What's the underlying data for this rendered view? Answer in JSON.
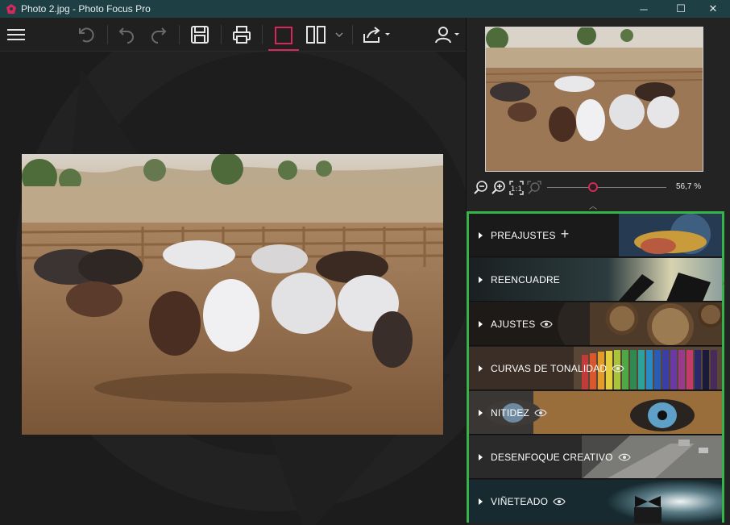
{
  "window": {
    "title": "Photo 2.jpg - Photo Focus Pro",
    "minimize": "─",
    "maximize": "☐",
    "close": "✕"
  },
  "toolbar": {
    "buttons": [
      "menu-icon",
      "undo-all-icon",
      "undo-icon",
      "redo-icon",
      "save-icon",
      "print-icon",
      "single-view-icon",
      "split-view-icon",
      "split-dropdown-icon",
      "share-icon",
      "account-icon"
    ]
  },
  "zoom": {
    "value": "56,7 %",
    "level": 0.385
  },
  "sections": [
    {
      "label": "PREAJUSTES",
      "extra": "+",
      "extra_icon": "plus-icon",
      "theme": "lamp"
    },
    {
      "label": "REENCUADRE",
      "extra": "",
      "extra_icon": "",
      "theme": "hands"
    },
    {
      "label": "AJUSTES",
      "extra": "",
      "extra_icon": "eye-icon",
      "theme": "gears"
    },
    {
      "label": "CURVAS DE TONALIDAD",
      "extra": "",
      "extra_icon": "eye-icon",
      "theme": "pencils"
    },
    {
      "label": "NITIDEZ",
      "extra": "",
      "extra_icon": "eye-icon",
      "theme": "tiger"
    },
    {
      "label": "DESENFOQUE CREATIVO",
      "extra": "",
      "extra_icon": "eye-icon",
      "theme": "city"
    },
    {
      "label": "VIÑETEADO",
      "extra": "",
      "extra_icon": "eye-icon",
      "theme": "bowtie"
    }
  ],
  "colors": {
    "accent": "#d6285a",
    "highlight_border": "#36b44a",
    "titlebar": "#1e3f44"
  }
}
